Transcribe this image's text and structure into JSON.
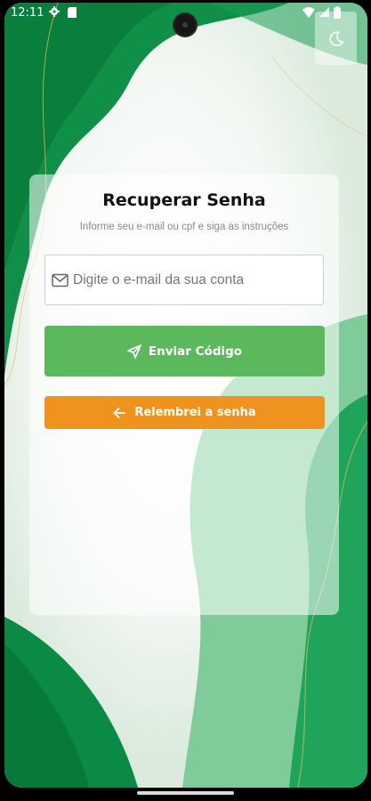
{
  "status_bar": {
    "time": "12:11",
    "icons": [
      "settings-gear-icon",
      "sd-card-icon",
      "wifi-icon",
      "signal-icon",
      "battery-icon"
    ]
  },
  "theme_toggle": {
    "icon": "moon-icon"
  },
  "card": {
    "title": "Recuperar Senha",
    "subtitle": "Informe seu e-mail ou cpf e siga as instruções"
  },
  "email_input": {
    "icon": "mail-icon",
    "placeholder": "Digite o e-mail da sua conta",
    "value": ""
  },
  "send_button": {
    "icon": "send-icon",
    "label": "Enviar Código"
  },
  "back_button": {
    "icon": "arrow-left-icon",
    "label": "Relembrei a senha"
  },
  "colors": {
    "primary_green": "#5cb85c",
    "dark_green": "#0a8a44",
    "accent_orange": "#f0931e",
    "card_bg": "#ffffff",
    "text_dark": "#111111",
    "text_muted": "#8a8a8a"
  }
}
